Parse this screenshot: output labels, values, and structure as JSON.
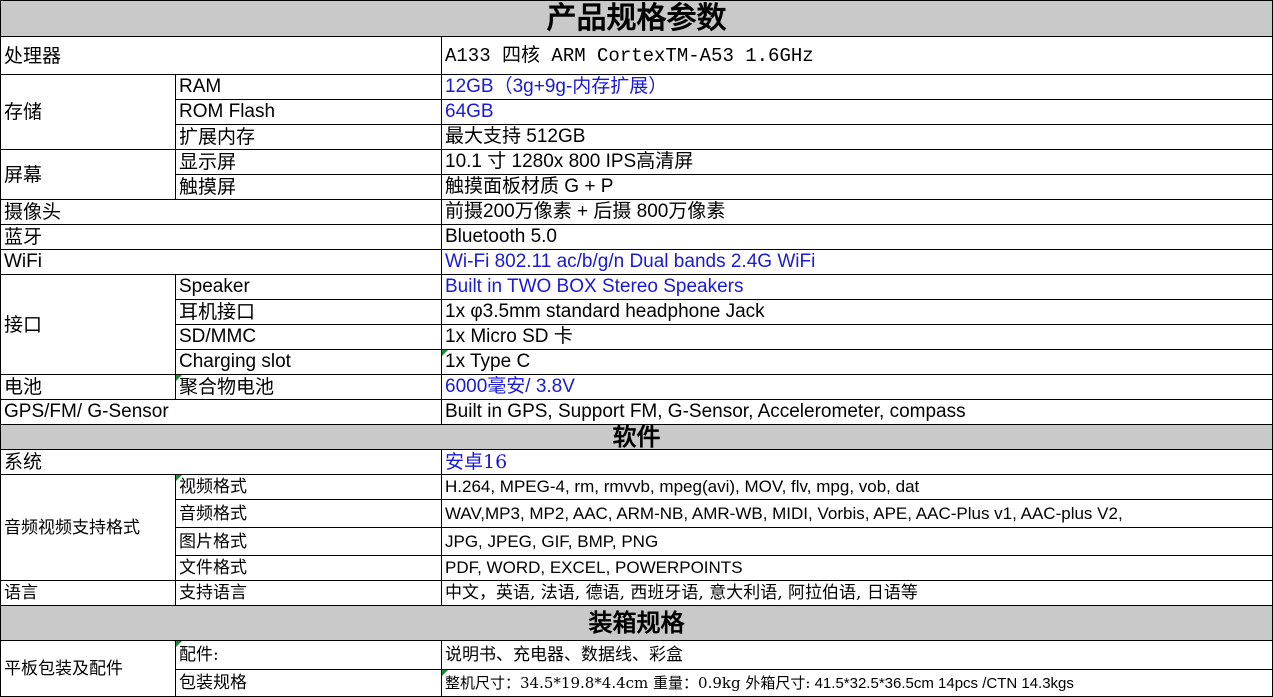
{
  "title": "产品规格参数",
  "rows": {
    "cpu": {
      "label": "处理器",
      "value": "A133 四核  ARM CortexTM-A53 1.6GHz"
    },
    "storage": {
      "label": "存储",
      "ram": {
        "label": "RAM",
        "value": "12GB（3g+9g-内存扩展）"
      },
      "rom": {
        "label": "ROM Flash",
        "value": "64GB"
      },
      "ext": {
        "label": "扩展内存",
        "value": "最大支持 512GB"
      }
    },
    "screen": {
      "label": "屏幕",
      "display": {
        "label": "显示屏",
        "value": "10.1 寸 1280x 800  IPS高清屏"
      },
      "touch": {
        "label": "触摸屏",
        "value": "触摸面板材质 G + P"
      }
    },
    "camera": {
      "label": "摄像头",
      "value": "前摄200万像素 + 后摄 800万像素"
    },
    "bluetooth": {
      "label": "蓝牙",
      "value": "Bluetooth 5.0"
    },
    "wifi": {
      "label": "WiFi",
      "value": "Wi-Fi 802.11 ac/b/g/n  Dual bands 2.4G WiFi"
    },
    "ports": {
      "label": "接口",
      "speaker": {
        "label": "Speaker",
        "value": "Built in TWO BOX Stereo Speakers"
      },
      "headphone": {
        "label": "耳机接口",
        "value": "1x φ3.5mm standard headphone Jack"
      },
      "sd": {
        "label": "SD/MMC",
        "value": "1x Micro SD 卡"
      },
      "charging": {
        "label": "Charging slot",
        "value": "1x Type C"
      }
    },
    "battery": {
      "label": "电池",
      "sub": "聚合物电池",
      "value": " 6000毫安/ 3.8V"
    },
    "gps": {
      "label": "GPS/FM/ G-Sensor",
      "value": "Built in GPS, Support FM, G-Sensor, Accelerometer, compass"
    }
  },
  "software": {
    "title": "软件",
    "system": {
      "label": "系统",
      "value": "安卓16"
    },
    "media": {
      "label": "音频视频支持格式",
      "video": {
        "label": "视频格式",
        "value": "H.264, MPEG-4, rm, rmvvb, mpeg(avi), MOV, flv, mpg, vob, dat"
      },
      "audio": {
        "label": "音频格式",
        "value": "WAV,MP3, MP2, AAC, ARM-NB, AMR-WB, MIDI, Vorbis, APE, AAC-Plus v1, AAC-plus V2,"
      },
      "image": {
        "label": "图片格式",
        "value": "JPG, JPEG, GIF, BMP, PNG"
      },
      "file": {
        "label": "文件格式",
        "value": "PDF, WORD, EXCEL, POWERPOINTS"
      }
    },
    "language": {
      "label": "语言",
      "sub": "支持语言",
      "value": "中文，英语, 法语, 德语, 西班牙语, 意大利语, 阿拉伯语, 日语等"
    }
  },
  "packing": {
    "title": "装箱规格",
    "label": "平板包装及配件",
    "accessories": {
      "label": "配件:",
      "value": "说明书、充电器、数据线、彩盒"
    },
    "spec": {
      "label": "包装规格",
      "value_a": "整机尺寸：34.5*19.8*4.4cm  重量：0.9kg   外箱尺寸:",
      "value_b": " 41.5*32.5*36.5cm  14pcs /CTN   14.3kgs"
    }
  },
  "colors": {
    "header_bg": "#c9c9c9",
    "value_blue": "#1a1ad6",
    "corner_marker": "#1f8a2e"
  }
}
